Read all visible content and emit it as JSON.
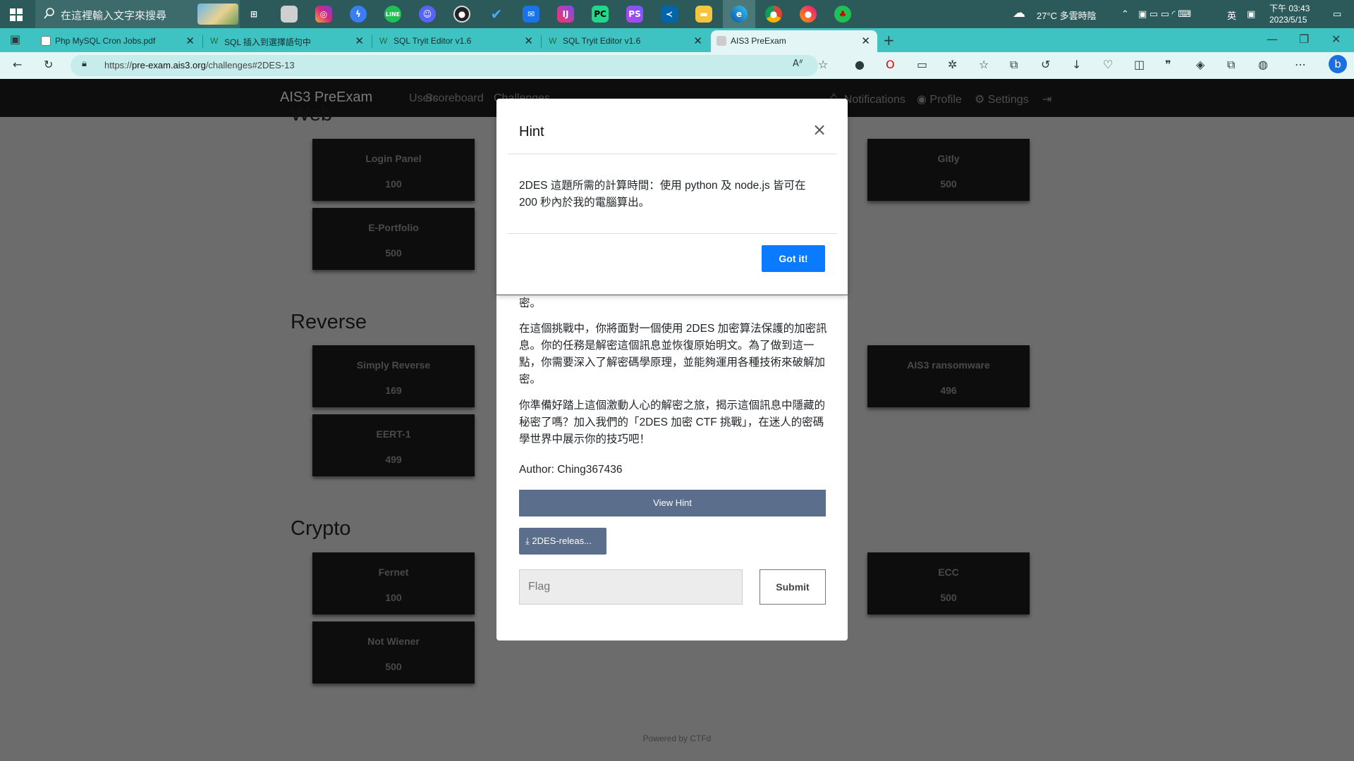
{
  "taskbar": {
    "search_placeholder": "在這裡輸入文字來搜尋",
    "weather": "27°C 多雲時陰",
    "ime": "英",
    "time": "下午 03:43",
    "date": "2023/5/15"
  },
  "tabs": [
    {
      "title": "Php MySQL Cron Jobs.pdf",
      "active": false
    },
    {
      "title": "SQL 插入到選擇語句中",
      "active": false
    },
    {
      "title": "SQL Tryit Editor v1.6",
      "active": false
    },
    {
      "title": "SQL Tryit Editor v1.6",
      "active": false
    },
    {
      "title": "AIS3 PreExam",
      "active": true
    }
  ],
  "address": {
    "prefix": "https://",
    "host": "pre-exam.ais3.org",
    "path": "/challenges#2DES-13"
  },
  "nav": {
    "brand": "AIS3 PreExam",
    "users": "Users",
    "scoreboard": "Scoreboard",
    "challenges": "Challenges",
    "notifications": "Notifications",
    "profile": "Profile",
    "settings": "Settings"
  },
  "sections": {
    "web": "Web",
    "reverse": "Reverse",
    "crypto": "Crypto"
  },
  "cards": {
    "login_panel": {
      "name": "Login Panel",
      "points": "100"
    },
    "gitly": {
      "name": "Gitly",
      "points": "500"
    },
    "e_portfolio": {
      "name": "E-Portfolio",
      "points": "500"
    },
    "simply_reverse": {
      "name": "Simply Reverse",
      "points": "169"
    },
    "ais3_ransomware": {
      "name": "AIS3 ransomware",
      "points": "496"
    },
    "eert_1": {
      "name": "EERT-1",
      "points": "499"
    },
    "fernet": {
      "name": "Fernet",
      "points": "100"
    },
    "ecc": {
      "name": "ECC",
      "points": "500"
    },
    "not_wiener": {
      "name": "Not Wiener",
      "points": "500"
    }
  },
  "challenge_modal": {
    "desc_tail": "密。",
    "para1": "在這個挑戰中，你將面對一個使用 2DES 加密算法保護的加密訊息。你的任務是解密這個訊息並恢復原始明文。為了做到這一點，你需要深入了解密碼學原理，並能夠運用各種技術來破解加密。",
    "para2": "你準備好踏上這個激動人心的解密之旅，揭示這個訊息中隱藏的秘密了嗎？加入我們的「2DES 加密 CTF 挑戰」，在迷人的密碼學世界中展示你的技巧吧！",
    "author": "Author: Ching367436",
    "view_hint": "View Hint",
    "download": "2DES-releas...",
    "flag_placeholder": "Flag",
    "submit": "Submit"
  },
  "hint_modal": {
    "title": "Hint",
    "close": "×",
    "body": "2DES 這題所需的計算時間：使用 python 及 node.js 皆可在 200 秒內於我的電腦算出。",
    "got_it": "Got it!"
  },
  "footer": "Powered by CTFd",
  "colors": {
    "taskbar": "#2c5a5a",
    "tabbar": "#3fc2c2",
    "primary_button": "#0a7bff",
    "secondary_button": "#5b6e8c"
  }
}
